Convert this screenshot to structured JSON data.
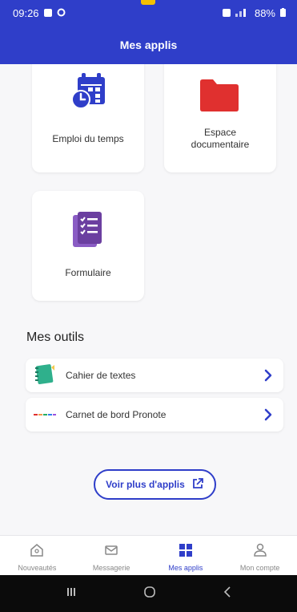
{
  "status": {
    "time": "09:26",
    "battery": "88%"
  },
  "header": {
    "title": "Mes applis"
  },
  "apps": [
    {
      "label": "Emploi du temps",
      "icon": "calendar-clock-icon"
    },
    {
      "label": "Espace documentaire",
      "icon": "folder-icon"
    },
    {
      "label": "Formulaire",
      "icon": "checklist-form-icon"
    }
  ],
  "tools": {
    "title": "Mes outils",
    "items": [
      {
        "label": "Cahier de textes",
        "icon": "notebook-icon"
      },
      {
        "label": "Carnet de bord Pronote",
        "icon": "pronote-logo-icon"
      }
    ]
  },
  "more_button": {
    "label": "Voir plus d'applis",
    "icon": "external-link-icon"
  },
  "bottom_nav": [
    {
      "label": "Nouveautés",
      "icon": "home-icon",
      "active": false
    },
    {
      "label": "Messagerie",
      "icon": "mail-icon",
      "active": false
    },
    {
      "label": "Mes applis",
      "icon": "grid-icon",
      "active": true
    },
    {
      "label": "Mon compte",
      "icon": "user-icon",
      "active": false
    }
  ],
  "colors": {
    "primary": "#2f3ec9",
    "folder": "#e0302f",
    "form": "#6b3fa0",
    "notebook": "#2fb08c"
  }
}
